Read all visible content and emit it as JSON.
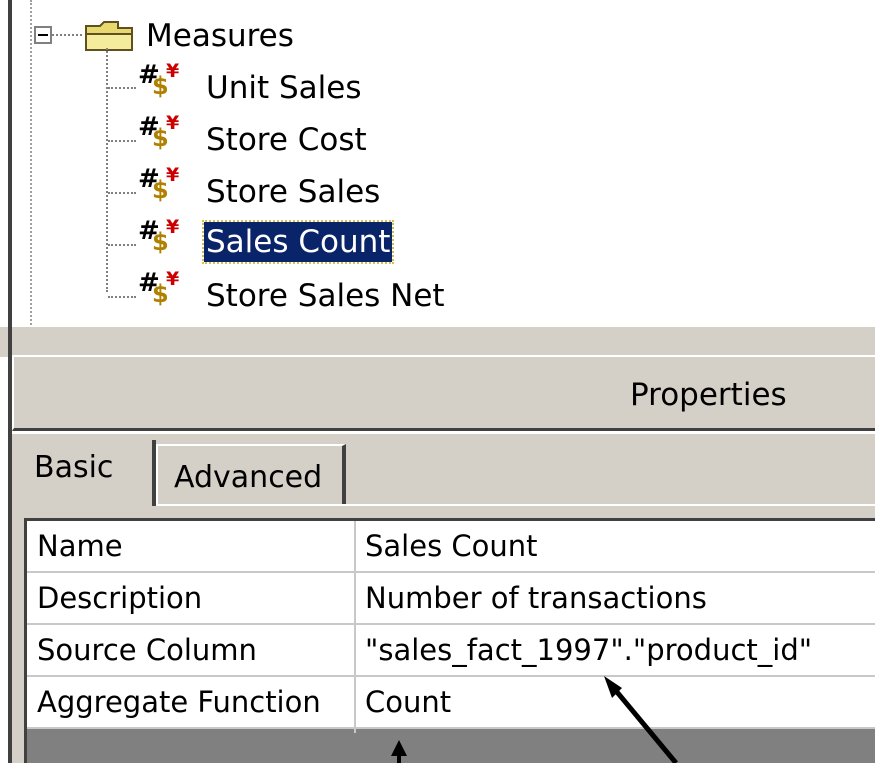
{
  "tree": {
    "root_label": "Measures",
    "items": [
      {
        "label": "Unit Sales",
        "selected": false
      },
      {
        "label": "Store Cost",
        "selected": false
      },
      {
        "label": "Store Sales",
        "selected": false
      },
      {
        "label": "Sales Count",
        "selected": true
      },
      {
        "label": "Store Sales Net",
        "selected": false
      }
    ]
  },
  "properties": {
    "title": "Properties",
    "tabs": [
      {
        "label": "Basic",
        "active": true
      },
      {
        "label": "Advanced",
        "active": false
      }
    ],
    "rows": [
      {
        "label": "Name",
        "value": "Sales Count"
      },
      {
        "label": "Description",
        "value": "Number of transactions"
      },
      {
        "label": "Source Column",
        "value": "\"sales_fact_1997\".\"product_id\""
      },
      {
        "label": "Aggregate Function",
        "value": "Count"
      }
    ]
  },
  "colors": {
    "selection_bg": "#0a246a",
    "panel_bg": "#d4d0c8",
    "grid_bg": "#808080"
  }
}
